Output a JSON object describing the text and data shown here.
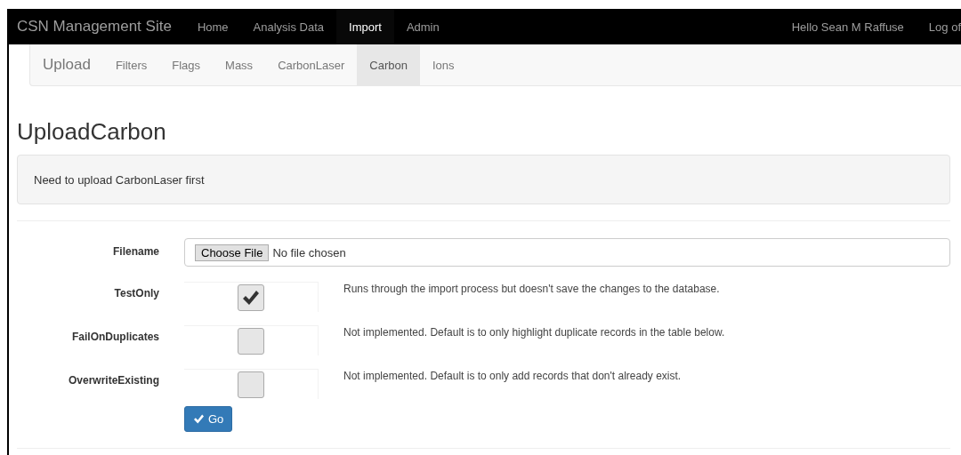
{
  "navbar": {
    "brand": "CSN Management Site",
    "items": [
      {
        "label": "Home",
        "selected": false
      },
      {
        "label": "Analysis Data",
        "selected": false
      },
      {
        "label": "Import",
        "selected": true
      },
      {
        "label": "Admin",
        "selected": false
      }
    ],
    "greeting": "Hello Sean M Raffuse",
    "logoff": "Log of"
  },
  "subnav": {
    "brand": "Upload",
    "items": [
      {
        "label": "Filters",
        "selected": false
      },
      {
        "label": "Flags",
        "selected": false
      },
      {
        "label": "Mass",
        "selected": false
      },
      {
        "label": "CarbonLaser",
        "selected": false
      },
      {
        "label": "Carbon",
        "selected": true
      },
      {
        "label": "Ions",
        "selected": false
      }
    ]
  },
  "title": "UploadCarbon",
  "alert": "Need to upload CarbonLaser first",
  "file_field": {
    "label": "Filename",
    "button": "Choose File",
    "value": "No file chosen"
  },
  "options": [
    {
      "label": "TestOnly",
      "checked": true,
      "help": "Runs through the import process but doesn't save the changes to the database."
    },
    {
      "label": "FailOnDuplicates",
      "checked": false,
      "help": "Not implemented. Default is to only highlight duplicate records in the table below."
    },
    {
      "label": "OverwriteExisting",
      "checked": false,
      "help": "Not implemented. Default is to only add records that don't already exist."
    }
  ],
  "submit": "Go"
}
